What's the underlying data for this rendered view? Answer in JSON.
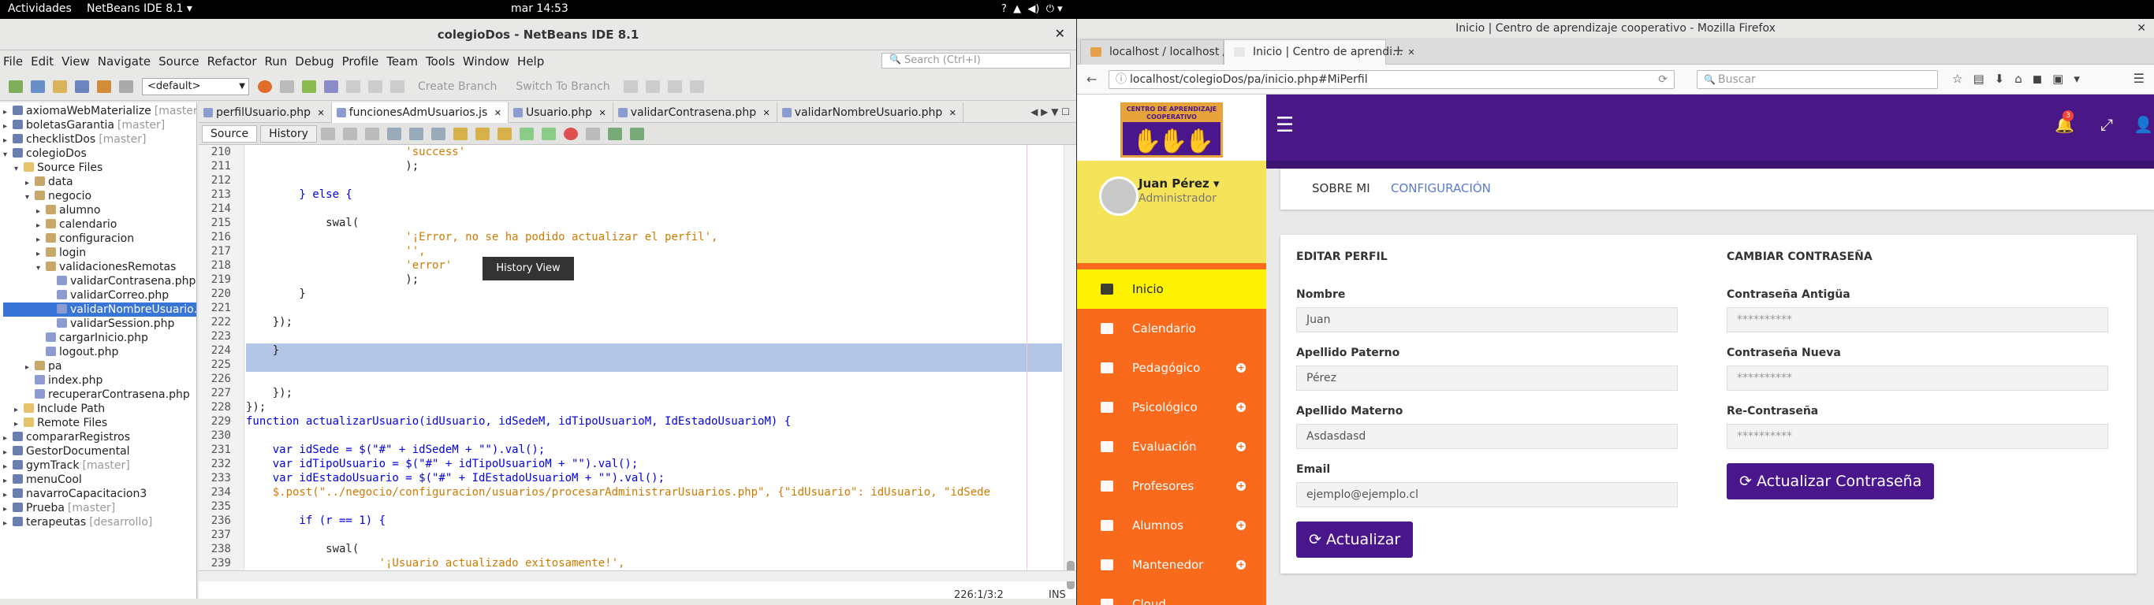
{
  "topbar": {
    "activities": "Actividades",
    "app": "NetBeans IDE 8.1 ▾",
    "clock": "mar 14:53"
  },
  "netbeans": {
    "title": "colegioDos - NetBeans IDE 8.1",
    "menu": [
      "File",
      "Edit",
      "View",
      "Navigate",
      "Source",
      "Refactor",
      "Run",
      "Debug",
      "Profile",
      "Team",
      "Tools",
      "Window",
      "Help"
    ],
    "search_placeholder": "Search (Ctrl+I)",
    "config": "<default>",
    "create_branch": "Create Branch",
    "switch_branch": "Switch To Branch",
    "tree": [
      {
        "label": "axiomaWebMaterialize",
        "extra": "[master]",
        "depth": 1,
        "icon": "proj"
      },
      {
        "label": "boletasGarantia",
        "extra": "[master]",
        "depth": 1,
        "icon": "proj"
      },
      {
        "label": "checklistDos",
        "extra": "[master]",
        "depth": 1,
        "icon": "proj"
      },
      {
        "label": "colegioDos",
        "extra": "",
        "depth": 1,
        "icon": "proj"
      },
      {
        "label": "Source Files",
        "extra": "",
        "depth": 2,
        "icon": "fold"
      },
      {
        "label": "data",
        "extra": "",
        "depth": 3,
        "icon": "pkg"
      },
      {
        "label": "negocio",
        "extra": "",
        "depth": 3,
        "icon": "pkg"
      },
      {
        "label": "alumno",
        "extra": "",
        "depth": 4,
        "icon": "pkg"
      },
      {
        "label": "calendario",
        "extra": "",
        "depth": 4,
        "icon": "pkg"
      },
      {
        "label": "configuracion",
        "extra": "",
        "depth": 4,
        "icon": "pkg"
      },
      {
        "label": "login",
        "extra": "",
        "depth": 4,
        "icon": "pkg"
      },
      {
        "label": "validacionesRemotas",
        "extra": "",
        "depth": 4,
        "icon": "pkg"
      },
      {
        "label": "validarContrasena.php",
        "extra": "",
        "depth": 5,
        "icon": "php"
      },
      {
        "label": "validarCorreo.php",
        "extra": "",
        "depth": 5,
        "icon": "php"
      },
      {
        "label": "validarNombreUsuario.php",
        "extra": "",
        "depth": 5,
        "icon": "php"
      },
      {
        "label": "validarSession.php",
        "extra": "",
        "depth": 5,
        "icon": "php"
      },
      {
        "label": "cargarInicio.php",
        "extra": "",
        "depth": 4,
        "icon": "php"
      },
      {
        "label": "logout.php",
        "extra": "",
        "depth": 4,
        "icon": "php"
      },
      {
        "label": "pa",
        "extra": "",
        "depth": 3,
        "icon": "pkg"
      },
      {
        "label": "index.php",
        "extra": "",
        "depth": 3,
        "icon": "php"
      },
      {
        "label": "recuperarContrasena.php",
        "extra": "",
        "depth": 3,
        "icon": "php"
      },
      {
        "label": "Include Path",
        "extra": "",
        "depth": 2,
        "icon": "fold"
      },
      {
        "label": "Remote Files",
        "extra": "",
        "depth": 2,
        "icon": "fold"
      },
      {
        "label": "compararRegistros",
        "extra": "",
        "depth": 1,
        "icon": "proj"
      },
      {
        "label": "GestorDocumental",
        "extra": "",
        "depth": 1,
        "icon": "proj"
      },
      {
        "label": "gymTrack",
        "extra": "[master]",
        "depth": 1,
        "icon": "proj"
      },
      {
        "label": "menuCool",
        "extra": "",
        "depth": 1,
        "icon": "proj"
      },
      {
        "label": "navarroCapacitacion3",
        "extra": "",
        "depth": 1,
        "icon": "proj"
      },
      {
        "label": "Prueba",
        "extra": "[master]",
        "depth": 1,
        "icon": "proj"
      },
      {
        "label": "terapeutas",
        "extra": "[desarrollo]",
        "depth": 1,
        "icon": "proj"
      }
    ],
    "tabs": [
      "perfilUsuario.php",
      "funcionesAdmUsuarios.js",
      "Usuario.php",
      "validarContrasena.php",
      "validarNombreUsuario.php"
    ],
    "source_tab": "Source",
    "history_tab": "History",
    "tooltip": "History View",
    "lines": [
      {
        "n": "210",
        "html": "                        'success'",
        "cls": "st"
      },
      {
        "n": "211",
        "html": "                        );",
        "cls": ""
      },
      {
        "n": "212",
        "html": "",
        "cls": ""
      },
      {
        "n": "213",
        "html": "        } else {",
        "cls": "kwline"
      },
      {
        "n": "214",
        "html": "",
        "cls": ""
      },
      {
        "n": "215",
        "html": "            swal(",
        "cls": ""
      },
      {
        "n": "216",
        "html": "                        '¡Error, no se ha podido actualizar el perfil',",
        "cls": "st"
      },
      {
        "n": "217",
        "html": "                        '',",
        "cls": "st"
      },
      {
        "n": "218",
        "html": "                        'error'",
        "cls": "st"
      },
      {
        "n": "219",
        "html": "                        );",
        "cls": ""
      },
      {
        "n": "220",
        "html": "        }",
        "cls": ""
      },
      {
        "n": "221",
        "html": "",
        "cls": ""
      },
      {
        "n": "222",
        "html": "    });",
        "cls": ""
      },
      {
        "n": "223",
        "html": "",
        "cls": ""
      },
      {
        "n": "224",
        "html": "    }",
        "cls": "sel"
      },
      {
        "n": "225",
        "html": "",
        "cls": "sel"
      },
      {
        "n": "226",
        "html": "",
        "cls": ""
      },
      {
        "n": "227",
        "html": "    });",
        "cls": ""
      },
      {
        "n": "228",
        "html": "});",
        "cls": ""
      },
      {
        "n": "229",
        "html": "function actualizarUsuario(idUsuario, idSedeM, idTipoUsuarioM, IdEstadoUsuarioM) {",
        "cls": "fnline"
      },
      {
        "n": "230",
        "html": "",
        "cls": ""
      },
      {
        "n": "231",
        "html": "    var idSede = $(\"#\" + idSedeM + \"\").val();",
        "cls": "varline"
      },
      {
        "n": "232",
        "html": "    var idTipoUsuario = $(\"#\" + idTipoUsuarioM + \"\").val();",
        "cls": "varline"
      },
      {
        "n": "233",
        "html": "    var idEstadoUsuario = $(\"#\" + IdEstadoUsuarioM + \"\").val();",
        "cls": "varline"
      },
      {
        "n": "234",
        "html": "    $.post(\"../negocio/configuracion/usuarios/procesarAdministrarUsuarios.php\", {\"idUsuario\": idUsuario, \"idSede",
        "cls": "post"
      },
      {
        "n": "235",
        "html": "",
        "cls": ""
      },
      {
        "n": "236",
        "html": "        if (r == 1) {",
        "cls": "kwline"
      },
      {
        "n": "237",
        "html": "",
        "cls": ""
      },
      {
        "n": "238",
        "html": "            swal(",
        "cls": ""
      },
      {
        "n": "239",
        "html": "                    '¡Usuario actualizado exitosamente!',",
        "cls": "st"
      }
    ],
    "status_pos": "226:1/3:2",
    "status_mode": "INS"
  },
  "firefox": {
    "title": "Inicio | Centro de aprendizaje cooperativo - Mozilla Firefox",
    "tabs": [
      "localhost / localhost / ...",
      "Inicio | Centro de aprendi..."
    ],
    "url": "localhost/colegioDos/pa/inicio.php#MiPerfil",
    "search_placeholder": "Buscar",
    "logo_text": "CENTRO DE APRENDIZAJE COOPERATIVO",
    "notif_count": "3",
    "user_name": "Juan Pérez",
    "user_role": "Administrador",
    "menu": [
      {
        "label": "Inicio",
        "plus": false
      },
      {
        "label": "Calendario",
        "plus": false
      },
      {
        "label": "Pedagógico",
        "plus": true
      },
      {
        "label": "Psicológico",
        "plus": true
      },
      {
        "label": "Evaluación",
        "plus": true
      },
      {
        "label": "Profesores",
        "plus": true
      },
      {
        "label": "Alumnos",
        "plus": true
      },
      {
        "label": "Mantenedor",
        "plus": true
      },
      {
        "label": "Cloud",
        "plus": false
      }
    ],
    "page_tabs": {
      "about": "SOBRE MI",
      "config": "CONFIGURACIÓN"
    },
    "edit": {
      "title": "EDITAR PERFIL",
      "name_label": "Nombre",
      "name_value": "Juan",
      "ap_label": "Apellido Paterno",
      "ap_value": "Pérez",
      "am_label": "Apellido Materno",
      "am_value": "Asdasdasd",
      "email_label": "Email",
      "email_value": "ejemplo@ejemplo.cl",
      "button": "⟳ Actualizar"
    },
    "pass": {
      "title": "CAMBIAR CONTRASEÑA",
      "old_label": "Contraseña Antigüa",
      "old_value": "**********",
      "new_label": "Contraseña Nueva",
      "new_value": "**********",
      "re_label": "Re-Contraseña",
      "re_value": "**********",
      "button": "⟳ Actualizar Contraseña"
    }
  }
}
